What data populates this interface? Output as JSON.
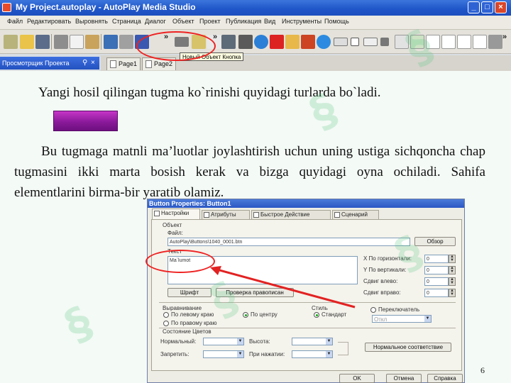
{
  "app": {
    "title": "My Project.autoplay - AutoPlay Media Studio",
    "menu": [
      "Файл",
      "Редактировать",
      "Выровнять",
      "Страница",
      "Диалог",
      "Объект",
      "Проект",
      "Публикация",
      "Вид",
      "Инструменты",
      "Помощь"
    ],
    "tooltip": "Новый Объект Кнопка",
    "panel_title": "Просмотрщик Проекта",
    "tabs": [
      "Page1",
      "Page2"
    ]
  },
  "slide": {
    "para1": "Yangi hosil qilingan tugma ko`rinishi quyidagi  turlarda  bo`ladi.",
    "para2": "Bu tugmaga matnli ma’luotlar joylashtirish uchun uning ustiga sichqoncha chap tugmasini ikki marta bosish kerak va bizga quyidagi oyna ochiladi. Sahifa elementlarini birma-bir yaratib olamiz.",
    "page_number": "6",
    "sample_button_color": "#9b1fa8"
  },
  "dialog": {
    "title": "Button Properties: Button1",
    "tabs": [
      "Настройки",
      "Атрибуты",
      "Быстрое Действие",
      "Сценарий"
    ],
    "group_object": "Объект",
    "file_label": "Файл:",
    "file_value": "AutoPlay\\Buttons\\1040_0001.btn",
    "browse_button": "Обзор",
    "text_label": "Текст",
    "text_value": "Ma`lumot",
    "font_button": "Шрифт",
    "spell_button": "Проверка правописан",
    "x_label": "X По горизонтали:",
    "y_label": "Y По вертикали:",
    "left_label": "Сдвиг влево:",
    "right_label": "Сдвиг вправо:",
    "spin_values": [
      "0",
      "0",
      "0",
      "0"
    ],
    "align_group": "Выравнивание",
    "align_left": "По левому краю",
    "align_center": "По центру",
    "align_right": "По правому краю",
    "style_group": "Стиль",
    "style_standard": "Стандарт",
    "style_toggle": "Переключатель",
    "toggle_combo": "Откл",
    "colors_group": "Состояние Цветов",
    "normal_label": "Нормальный:",
    "height_label": "Высота:",
    "disabled_label": "Запретить:",
    "click_label": "При нажатии:",
    "match_button": "Нормальное соответствие",
    "ok": "OK",
    "cancel": "Отмена",
    "help": "Справка"
  },
  "annotation": {
    "color": "#e22222"
  }
}
